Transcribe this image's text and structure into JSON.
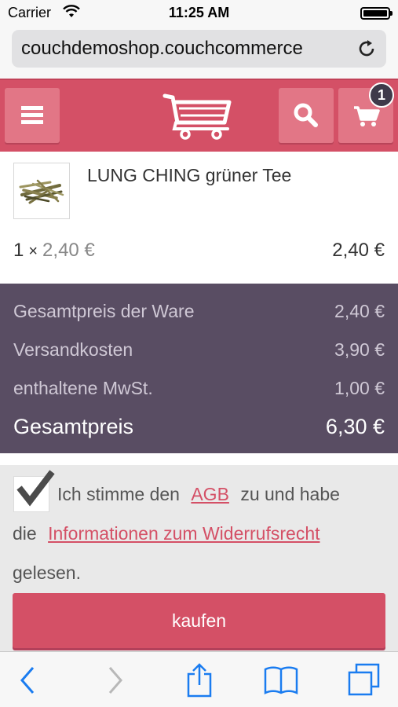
{
  "status_bar": {
    "carrier": "Carrier",
    "time": "11:25 AM"
  },
  "browser": {
    "url": "couchdemoshop.couchcommerce"
  },
  "header": {
    "cart_count": "1"
  },
  "product": {
    "name": "LUNG CHING grüner Tee",
    "quantity": "1",
    "times": "×",
    "unit_price": "2,40 €",
    "line_total": "2,40 €"
  },
  "summary": {
    "rows": [
      {
        "label": "Gesamtpreis der Ware",
        "value": "2,40 €"
      },
      {
        "label": "Versandkosten",
        "value": "3,90 €"
      },
      {
        "label": "enthaltene MwSt.",
        "value": "1,00 €"
      }
    ],
    "total_label": "Gesamtpreis",
    "total_value": "6,30 €"
  },
  "terms": {
    "checked": true,
    "text_before": "Ich stimme den",
    "agb_link": "AGB",
    "text_middle": "zu und habe",
    "text_die": "die",
    "widerruf_link": "Informationen zum Widerrufsrecht",
    "text_after": "gelesen."
  },
  "buy_button": {
    "label": "kaufen"
  },
  "colors": {
    "brand": "#d45066",
    "summary_bg": "#594d63",
    "toolbar_icon": "#1a7cf0"
  }
}
